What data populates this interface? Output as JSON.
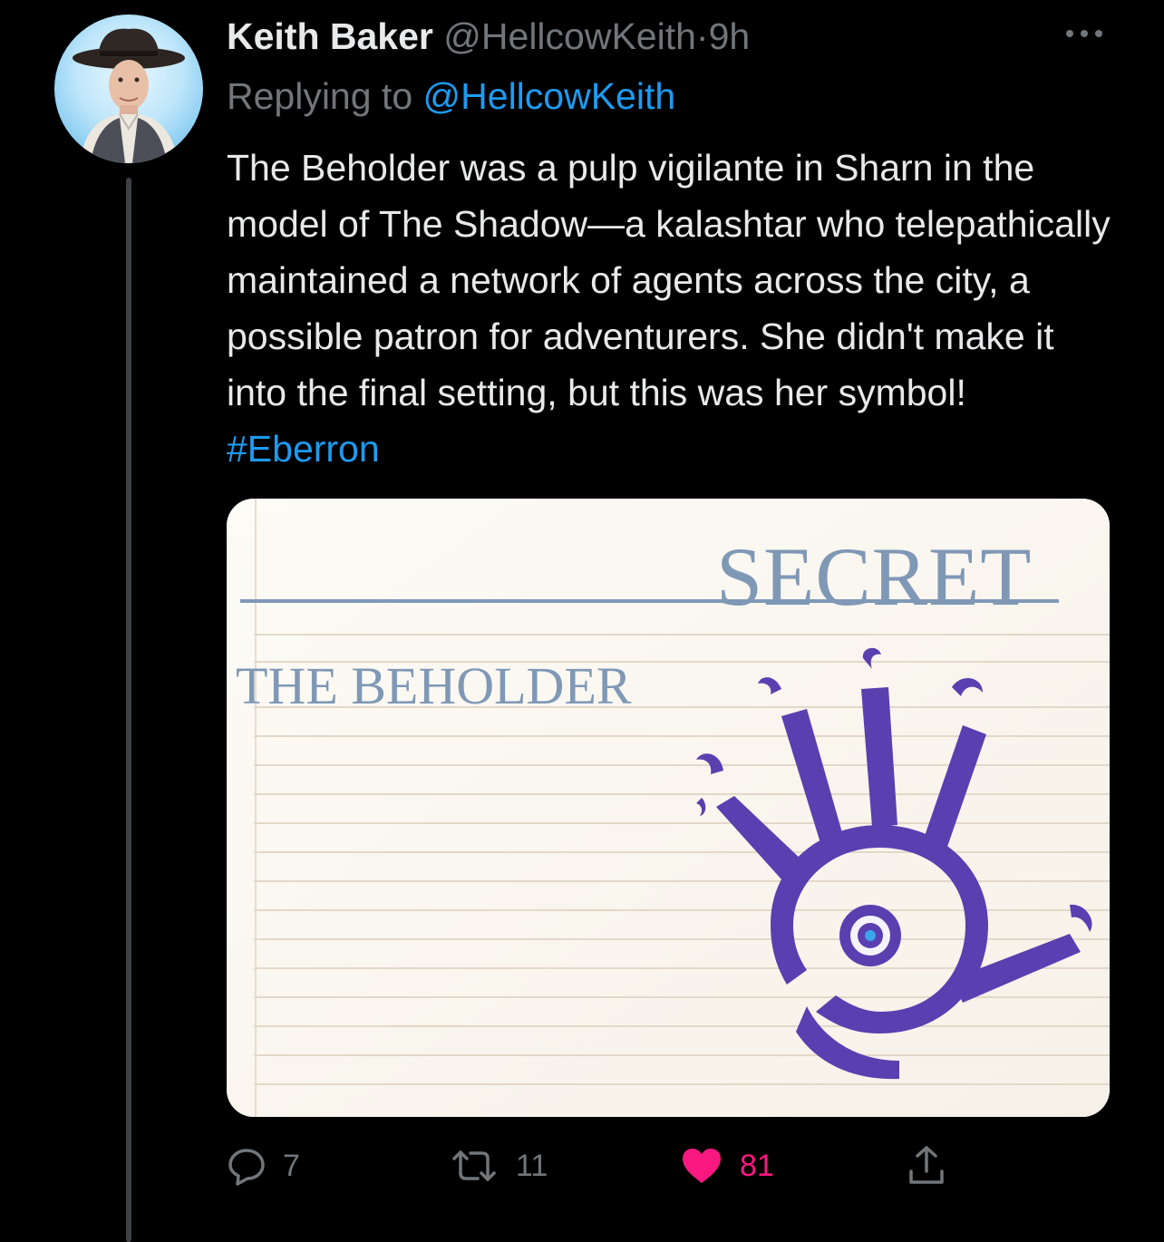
{
  "tweet": {
    "author_name": "Keith Baker",
    "author_handle": "@HellcowKeith",
    "separator": "·",
    "time": "9h",
    "replying_prefix": "Replying to",
    "replying_to": "@HellcowKeith",
    "text": "The Beholder was a pulp vigilante in Sharn in the model of The Shadow—a kalashtar who telepathically maintained a network of agents across the city, a possible patron for adventurers. She didn't make it into the final setting, but this was her symbol! ",
    "hashtag": "#Eberron"
  },
  "media": {
    "stamp_text": "SECRET",
    "card_title": "THE BEHOLDER"
  },
  "actions": {
    "reply_count": "7",
    "retweet_count": "11",
    "like_count": "81"
  },
  "icons": {
    "more": "more-dots-icon",
    "reply": "reply-bubble-icon",
    "retweet": "retweet-icon",
    "like": "heart-icon",
    "share": "share-upload-icon"
  },
  "colors": {
    "background": "#000000",
    "text": "#e7e9ea",
    "secondary": "#71767b",
    "link": "#1d9bf0",
    "like": "#f91880",
    "symbol_purple": "#5a3fb0",
    "card_ink": "#7f98b6"
  }
}
